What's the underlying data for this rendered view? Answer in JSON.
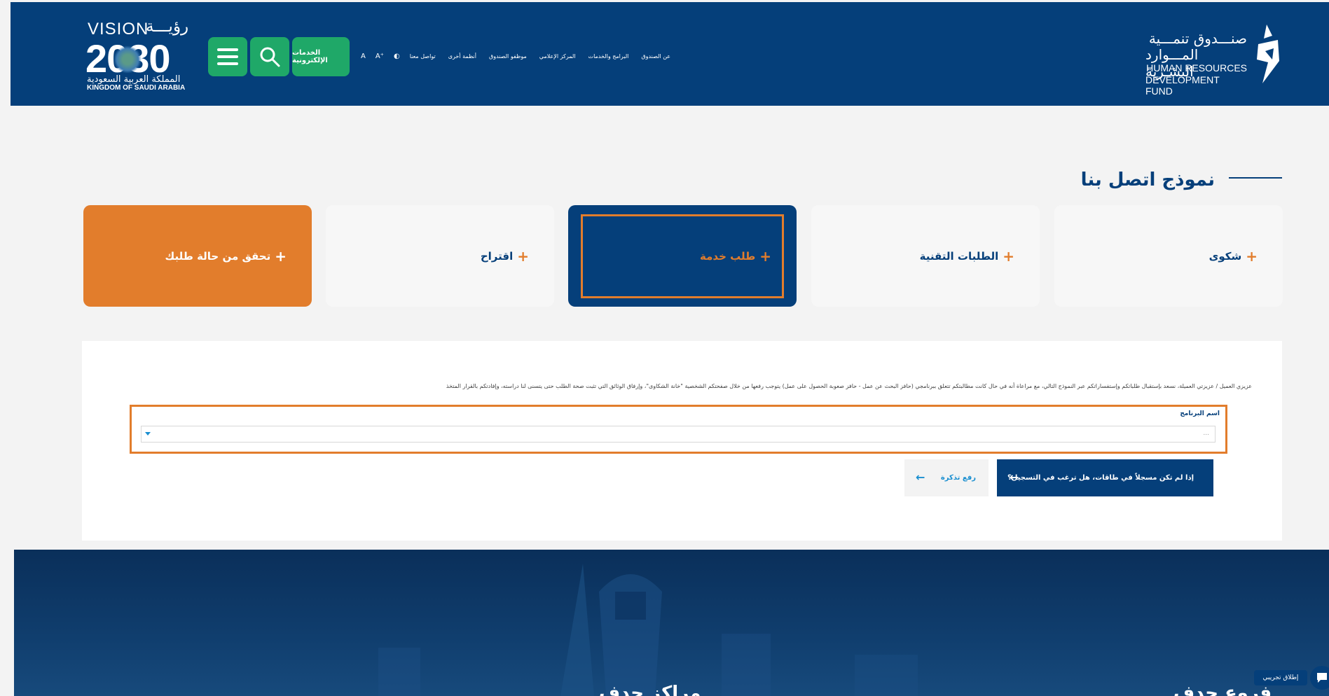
{
  "header": {
    "vision": {
      "vision_label": "VISION",
      "vision_ar": "رؤيـــة",
      "year": "2030",
      "kingdom_ar": "المملكة العربية السعودية",
      "kingdom_en": "KINGDOM OF SAUDI ARABIA"
    },
    "e_services_label": "الخدمات الإلكترونية",
    "nav_items": [
      "تواصل معنا",
      "أنظمة أخرى",
      "موظفو الصندوق",
      "المركز الإعلامي",
      "البرامج والخدمات",
      "عن الصندوق"
    ],
    "a11y": {
      "font_size": "A⁺",
      "font_size_small": "A",
      "contrast": "◐"
    },
    "hrdf": {
      "ar_line1": "صنـــدوق تنمـــية",
      "ar_line2": "المـــوارد البشـرية",
      "en_line1": "HUMAN RESOURCES",
      "en_line2": "DEVELOPMENT FUND"
    }
  },
  "page": {
    "title": "نموذج اتصل بنا"
  },
  "cards": [
    {
      "label": "شكوى",
      "plus": "+"
    },
    {
      "label": "الطلبات التقنية",
      "plus": "+"
    },
    {
      "label": "طلب خدمة",
      "plus": "+"
    },
    {
      "label": "اقتراح",
      "plus": "+"
    },
    {
      "label": "تحقق من حالة طلبك",
      "plus": "+"
    }
  ],
  "form": {
    "notice": "عزيزي العميل / عزيزتي العميلة، نسعد بإستقبال طلباتكم وإستفساراتكم عبر النموذج التالي، مع مراعاة أنه في حال كانت مطالبتكم تتعلق ببرنامجي (حافز البحث عن عمل - حافز صعوبة الحصول على عمل) يتوجب رفعها من خلال صفحتكم الشخصية \"خانة الشكاوى\"، وإرفاق الوثائق التي تثبت صحة الطلب حتى يتسنى لنا دراسته، وإفادتكم بالقرار المتخذ",
    "program_label": "اسم البرنامج",
    "program_value": "...",
    "register_button": "إذا لم تكن مسجلاً في طاقات، هل ترغب في التسجيل؟",
    "ticket_button": "رفع تذكرة",
    "arrow": "←"
  },
  "footer": {
    "heading_1": "مراكز حدف",
    "heading_2": "فروع حدف"
  },
  "chat": {
    "pill_label": "إطلاق تجريبي"
  },
  "colors": {
    "navy": "#053f7a",
    "orange": "#e27d2c",
    "green": "#1fa868",
    "link_blue": "#1a8fd0"
  }
}
